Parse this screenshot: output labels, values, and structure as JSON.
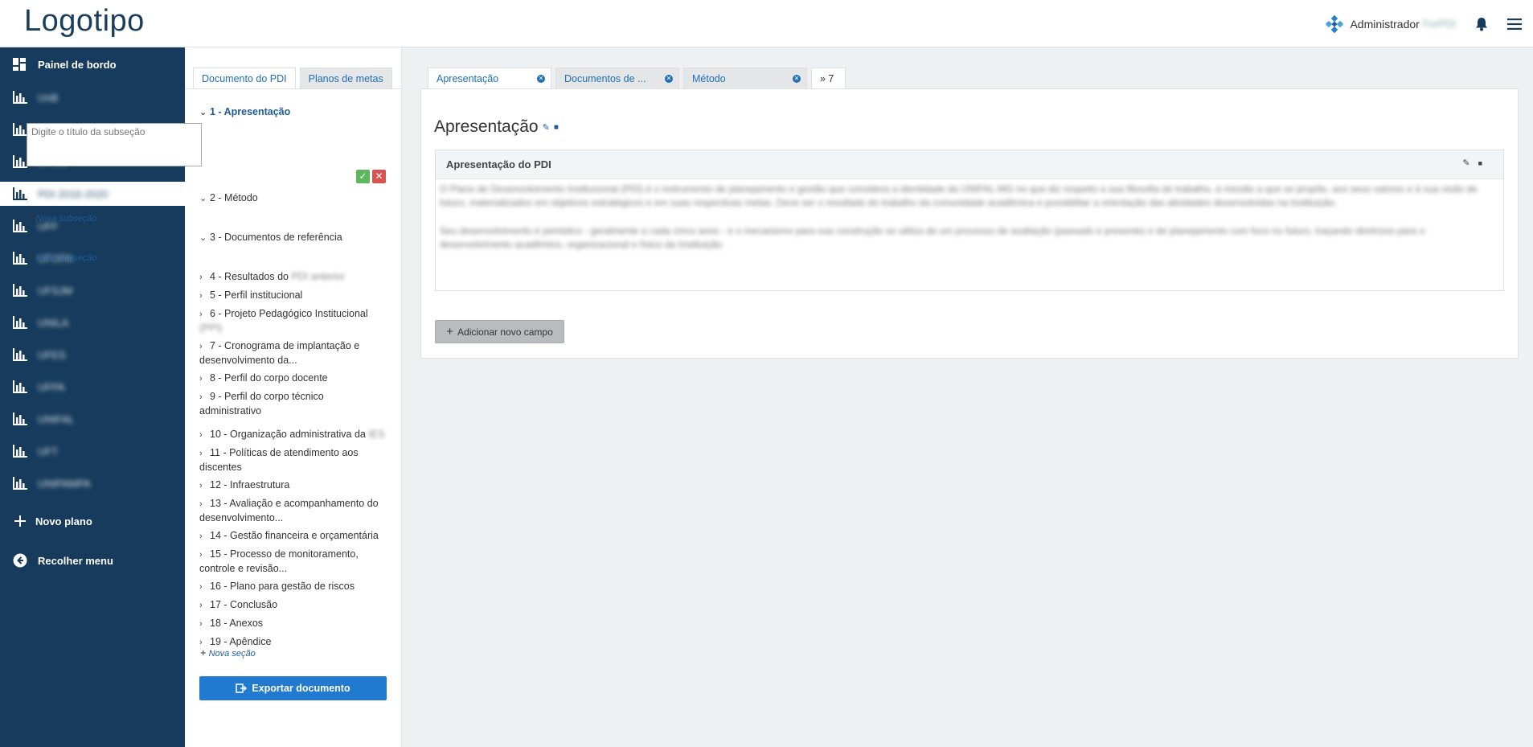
{
  "header": {
    "logo": "Logotipo",
    "user_label": "Administrador",
    "user_org": "ForPDI"
  },
  "sidebar": {
    "dashboard_label": "Painel de bordo",
    "plans": [
      "UnB",
      "UTFPR",
      "UFSM",
      "PDI 2016-2020",
      "UFF",
      "UFOPA",
      "UFSJM",
      "UNILA",
      "UFES",
      "UFPA",
      "UNIFAL",
      "UFT",
      "UNIPAMPA"
    ],
    "active_index": 3,
    "new_plan_label": "Novo plano",
    "collapse_label": "Recolher menu"
  },
  "tree": {
    "tabs": [
      "Documento do PDI",
      "Planos de metas"
    ],
    "subsection_placeholder": "Digite o título da subseção",
    "new_subsection_label": "Nova subseção",
    "new_section_label": "Nova seção",
    "items": [
      {
        "text": "1 - Apresentação"
      },
      {
        "text": "2 - Método"
      },
      {
        "text": "3 - Documentos de referência"
      },
      {
        "text": "4 - Resultados do ",
        "blur": "PDI anterior"
      },
      {
        "text": "5 - Perfil institucional"
      },
      {
        "text": "6 - Projeto Pedagógico Institucional",
        "blur2": "(PPI)"
      },
      {
        "text": "7 - Cronograma de implantação e",
        "text2": "desenvolvimento da..."
      },
      {
        "text": "8 - Perfil do corpo docente"
      },
      {
        "text": "9 - Perfil do corpo técnico",
        "text2": "administrativo"
      },
      {
        "text": "10 - Organização administrativa da ",
        "blur": "IES"
      },
      {
        "text": "11 - Políticas de atendimento aos",
        "text2": "discentes"
      },
      {
        "text": "12 - Infraestrutura"
      },
      {
        "text": "13 - Avaliação e acompanhamento do",
        "text2": "desenvolvimento..."
      },
      {
        "text": "14 - Gestão financeira e orçamentária"
      },
      {
        "text": "15 - Processo de monitoramento,",
        "text2": "controle e revisão..."
      },
      {
        "text": "16 - Plano para gestão de riscos"
      },
      {
        "text": "17 - Conclusão"
      },
      {
        "text": "18 - Anexos"
      },
      {
        "text": "19 - Apêndice"
      }
    ],
    "export_label": "Exportar documento"
  },
  "doc_tabs": [
    "Apresentação",
    "Documentos de ...",
    "Método"
  ],
  "doc_tabs_more": "» 7",
  "main": {
    "title": "Apresentação",
    "field_title": "Apresentação do PDI",
    "paragraph1": "O Plano de Desenvolvimento Institucional (PDI) é o instrumento de planejamento e gestão que considera a identidade da UNIFAL-MG no que diz respeito a sua filosofia de trabalho, à missão a que se propõe, aos seus valores e à sua visão de futuro, materializados em objetivos estratégicos e em suas respectivas metas. Deve ser o resultado do trabalho da comunidade acadêmica e possibilitar a orientação das atividades desenvolvidas na Instituição.",
    "paragraph2": "Seu desenvolvimento é periódico - geralmente a cada cinco anos - e o mecanismo para sua construção se utiliza de um processo de avaliação (passado e presente) e de planejamento com foco no futuro, traçando diretrizes para o desenvolvimento acadêmico, organizacional e físico da Instituição.",
    "add_field_label": "Adicionar novo campo"
  }
}
